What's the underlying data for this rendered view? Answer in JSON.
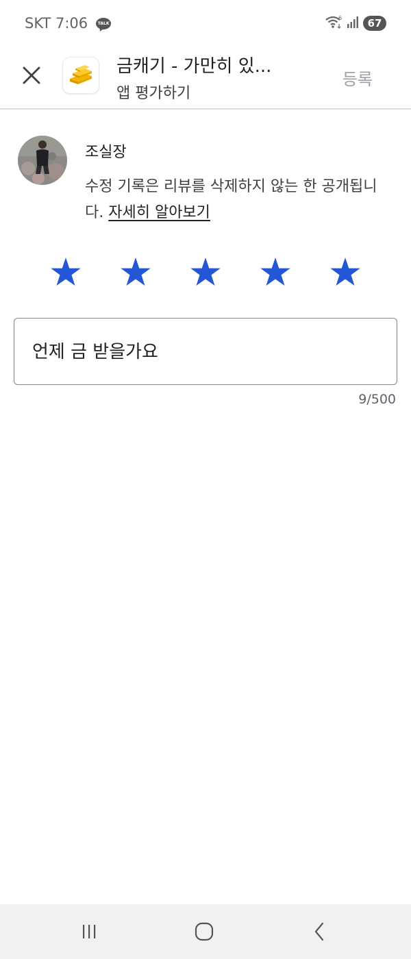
{
  "status_bar": {
    "carrier_time": "SKT 7:06",
    "talk_badge": "TALK",
    "battery": "67",
    "wifi_label": "6"
  },
  "header": {
    "app_title": "금캐기 - 가만히 있...",
    "subtitle": "앱 평가하기",
    "register_label": "등록"
  },
  "reviewer": {
    "name": "조실장",
    "notice_text": "수정 기록은 리뷰를 삭제하지 않는 한 공개됩니다. ",
    "learn_more": "자세히 알아보기"
  },
  "rating": {
    "value": 5,
    "max": 5,
    "star_color": "#2457d6"
  },
  "review": {
    "text": "언제 금 받을가요",
    "counter": "9/500"
  },
  "nav": {
    "items": [
      "recents-icon",
      "home-icon",
      "back-icon"
    ]
  }
}
